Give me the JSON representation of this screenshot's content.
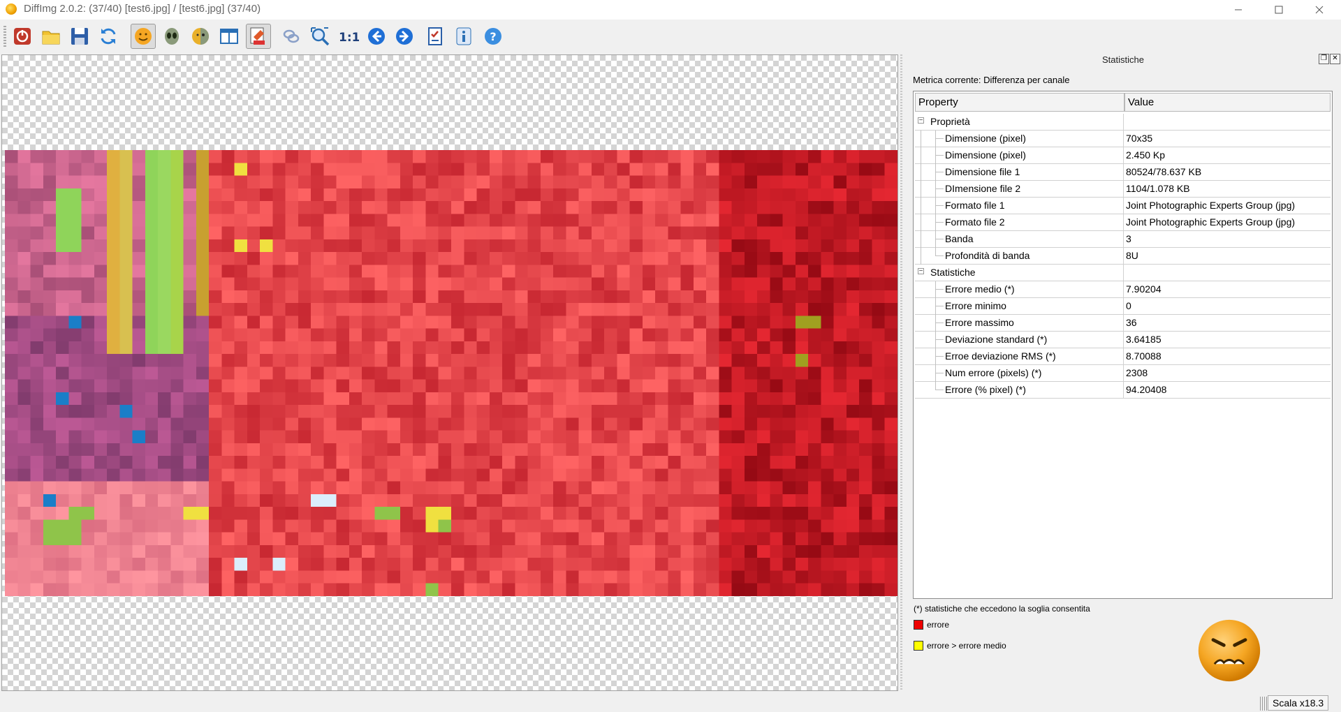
{
  "window": {
    "title": "DiffImg 2.0.2:  (37/40) [test6.jpg] / [test6.jpg] (37/40)"
  },
  "toolbar": {
    "buttons": [
      {
        "icon": "quit-icon",
        "active": false
      },
      {
        "icon": "open-folder-icon",
        "active": false
      },
      {
        "icon": "save-icon",
        "active": false
      },
      {
        "icon": "refresh-icon",
        "active": false
      },
      {
        "icon": "smiley-icon",
        "active": true
      },
      {
        "icon": "alien-icon",
        "active": false
      },
      {
        "icon": "mixed-smiley-icon",
        "active": false
      },
      {
        "icon": "split-view-icon",
        "active": false
      },
      {
        "icon": "difference-mask-icon",
        "active": true
      },
      {
        "icon": "link-icon",
        "active": false
      },
      {
        "icon": "zoom-fit-icon",
        "active": false
      },
      {
        "icon": "zoom-one-to-one-icon",
        "label": "1:1",
        "active": false
      },
      {
        "icon": "previous-arrow-icon",
        "active": false
      },
      {
        "icon": "next-arrow-icon",
        "active": false
      },
      {
        "icon": "checklist-icon",
        "active": false
      },
      {
        "icon": "info-icon",
        "active": false
      },
      {
        "icon": "help-icon",
        "active": false
      }
    ]
  },
  "stats": {
    "dock_title": "Statistiche",
    "metric_label": "Metrica corrente: Differenza per canale",
    "headers": {
      "property": "Property",
      "value": "Value"
    },
    "groups": [
      {
        "name": "Proprietà",
        "rows": [
          {
            "property": "Dimensione (pixel)",
            "value": "70x35"
          },
          {
            "property": "Dimensione (pixel)",
            "value": "2.450 Kp"
          },
          {
            "property": "Dimensione file 1",
            "value": "80524/78.637 KB"
          },
          {
            "property": "DImensione file 2",
            "value": "1104/1.078 KB"
          },
          {
            "property": "Formato file 1",
            "value": "Joint Photographic Experts Group (jpg)"
          },
          {
            "property": "Formato file 2",
            "value": "Joint Photographic Experts Group (jpg)"
          },
          {
            "property": "Banda",
            "value": "3"
          },
          {
            "property": "Profondità di banda",
            "value": "8U"
          }
        ]
      },
      {
        "name": "Statistiche",
        "rows": [
          {
            "property": "Errore medio (*)",
            "value": "7.90204"
          },
          {
            "property": "Errore minimo",
            "value": "0"
          },
          {
            "property": "Errore massimo",
            "value": "36"
          },
          {
            "property": "Deviazione standard (*)",
            "value": "3.64185"
          },
          {
            "property": "Erroe deviazione RMS (*)",
            "value": "8.70088"
          },
          {
            "property": "Num errore (pixels) (*)",
            "value": "2308"
          },
          {
            "property": "Errore (% pixel) (*)",
            "value": "94.20408"
          }
        ]
      }
    ],
    "footnote": "(*) statistiche che eccedono la soglia consentita",
    "legend": [
      {
        "label": "errore",
        "color": "#ee0000"
      },
      {
        "label": "errore > errore medio",
        "color": "#ffff00"
      }
    ]
  },
  "status": {
    "zoom": "Scala x18.3"
  },
  "image": {
    "pixel_grid": {
      "cols": 70,
      "rows": 35
    }
  }
}
